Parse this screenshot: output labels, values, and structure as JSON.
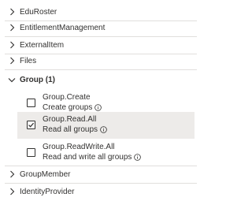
{
  "groups_before": [
    {
      "label": "EduRoster",
      "expanded": false
    },
    {
      "label": "EntitlementManagement",
      "expanded": false
    },
    {
      "label": "ExternalItem",
      "expanded": false
    },
    {
      "label": "Files",
      "expanded": false
    }
  ],
  "expanded_group": {
    "label": "Group (1)",
    "icon": "chevron-down-icon",
    "permissions": [
      {
        "name": "Group.Create",
        "description": "Create groups",
        "checked": false
      },
      {
        "name": "Group.Read.All",
        "description": "Read all groups",
        "checked": true
      },
      {
        "name": "Group.ReadWrite.All",
        "description": "Read and write all groups",
        "checked": false
      }
    ]
  },
  "groups_after": [
    {
      "label": "GroupMember",
      "expanded": false
    },
    {
      "label": "IdentityProvider",
      "expanded": false
    }
  ],
  "colors": {
    "text": "#323130",
    "divider": "#e1dfdd",
    "selected_row": "#edebe9"
  }
}
